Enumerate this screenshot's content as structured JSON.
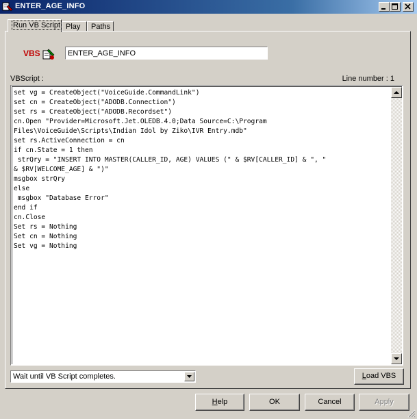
{
  "window": {
    "title": "ENTER_AGE_INFO"
  },
  "tabs": [
    {
      "label": "Run VB Script",
      "active": true
    },
    {
      "label": "Play",
      "active": false
    },
    {
      "label": "Paths",
      "active": false
    }
  ],
  "script_icon_text": "VBS",
  "name_field": {
    "value": "ENTER_AGE_INFO"
  },
  "editor": {
    "label": "VBScript :",
    "line_number": "Line number : 1",
    "code": "set vg = CreateObject(\"VoiceGuide.CommandLink\")\nset cn = CreateObject(\"ADODB.Connection\")\nset rs = CreateObject(\"ADODB.Recordset\")\ncn.Open \"Provider=Microsoft.Jet.OLEDB.4.0;Data Source=C:\\Program\nFiles\\VoiceGuide\\Scripts\\Indian Idol by Ziko\\IVR Entry.mdb\"\nset rs.ActiveConnection = cn\nif cn.State = 1 then\n strQry = \"INSERT INTO MASTER(CALLER_ID, AGE) VALUES (\" & $RV[CALLER_ID] & \", \"\n& $RV[WELCOME_AGE] & \")\"\nmsgbox strQry\nelse\n msgbox \"Database Error\"\nend if\ncn.Close\nSet rs = Nothing\nSet cn = Nothing\nSet vg = Nothing"
  },
  "wait_option": {
    "selected": "Wait until VB Script completes."
  },
  "buttons": {
    "load_vbs": {
      "pre": "L",
      "rest": "oad VBS"
    },
    "help": {
      "pre": "H",
      "rest": "elp"
    },
    "ok": "OK",
    "cancel": "Cancel",
    "apply": "Apply"
  }
}
